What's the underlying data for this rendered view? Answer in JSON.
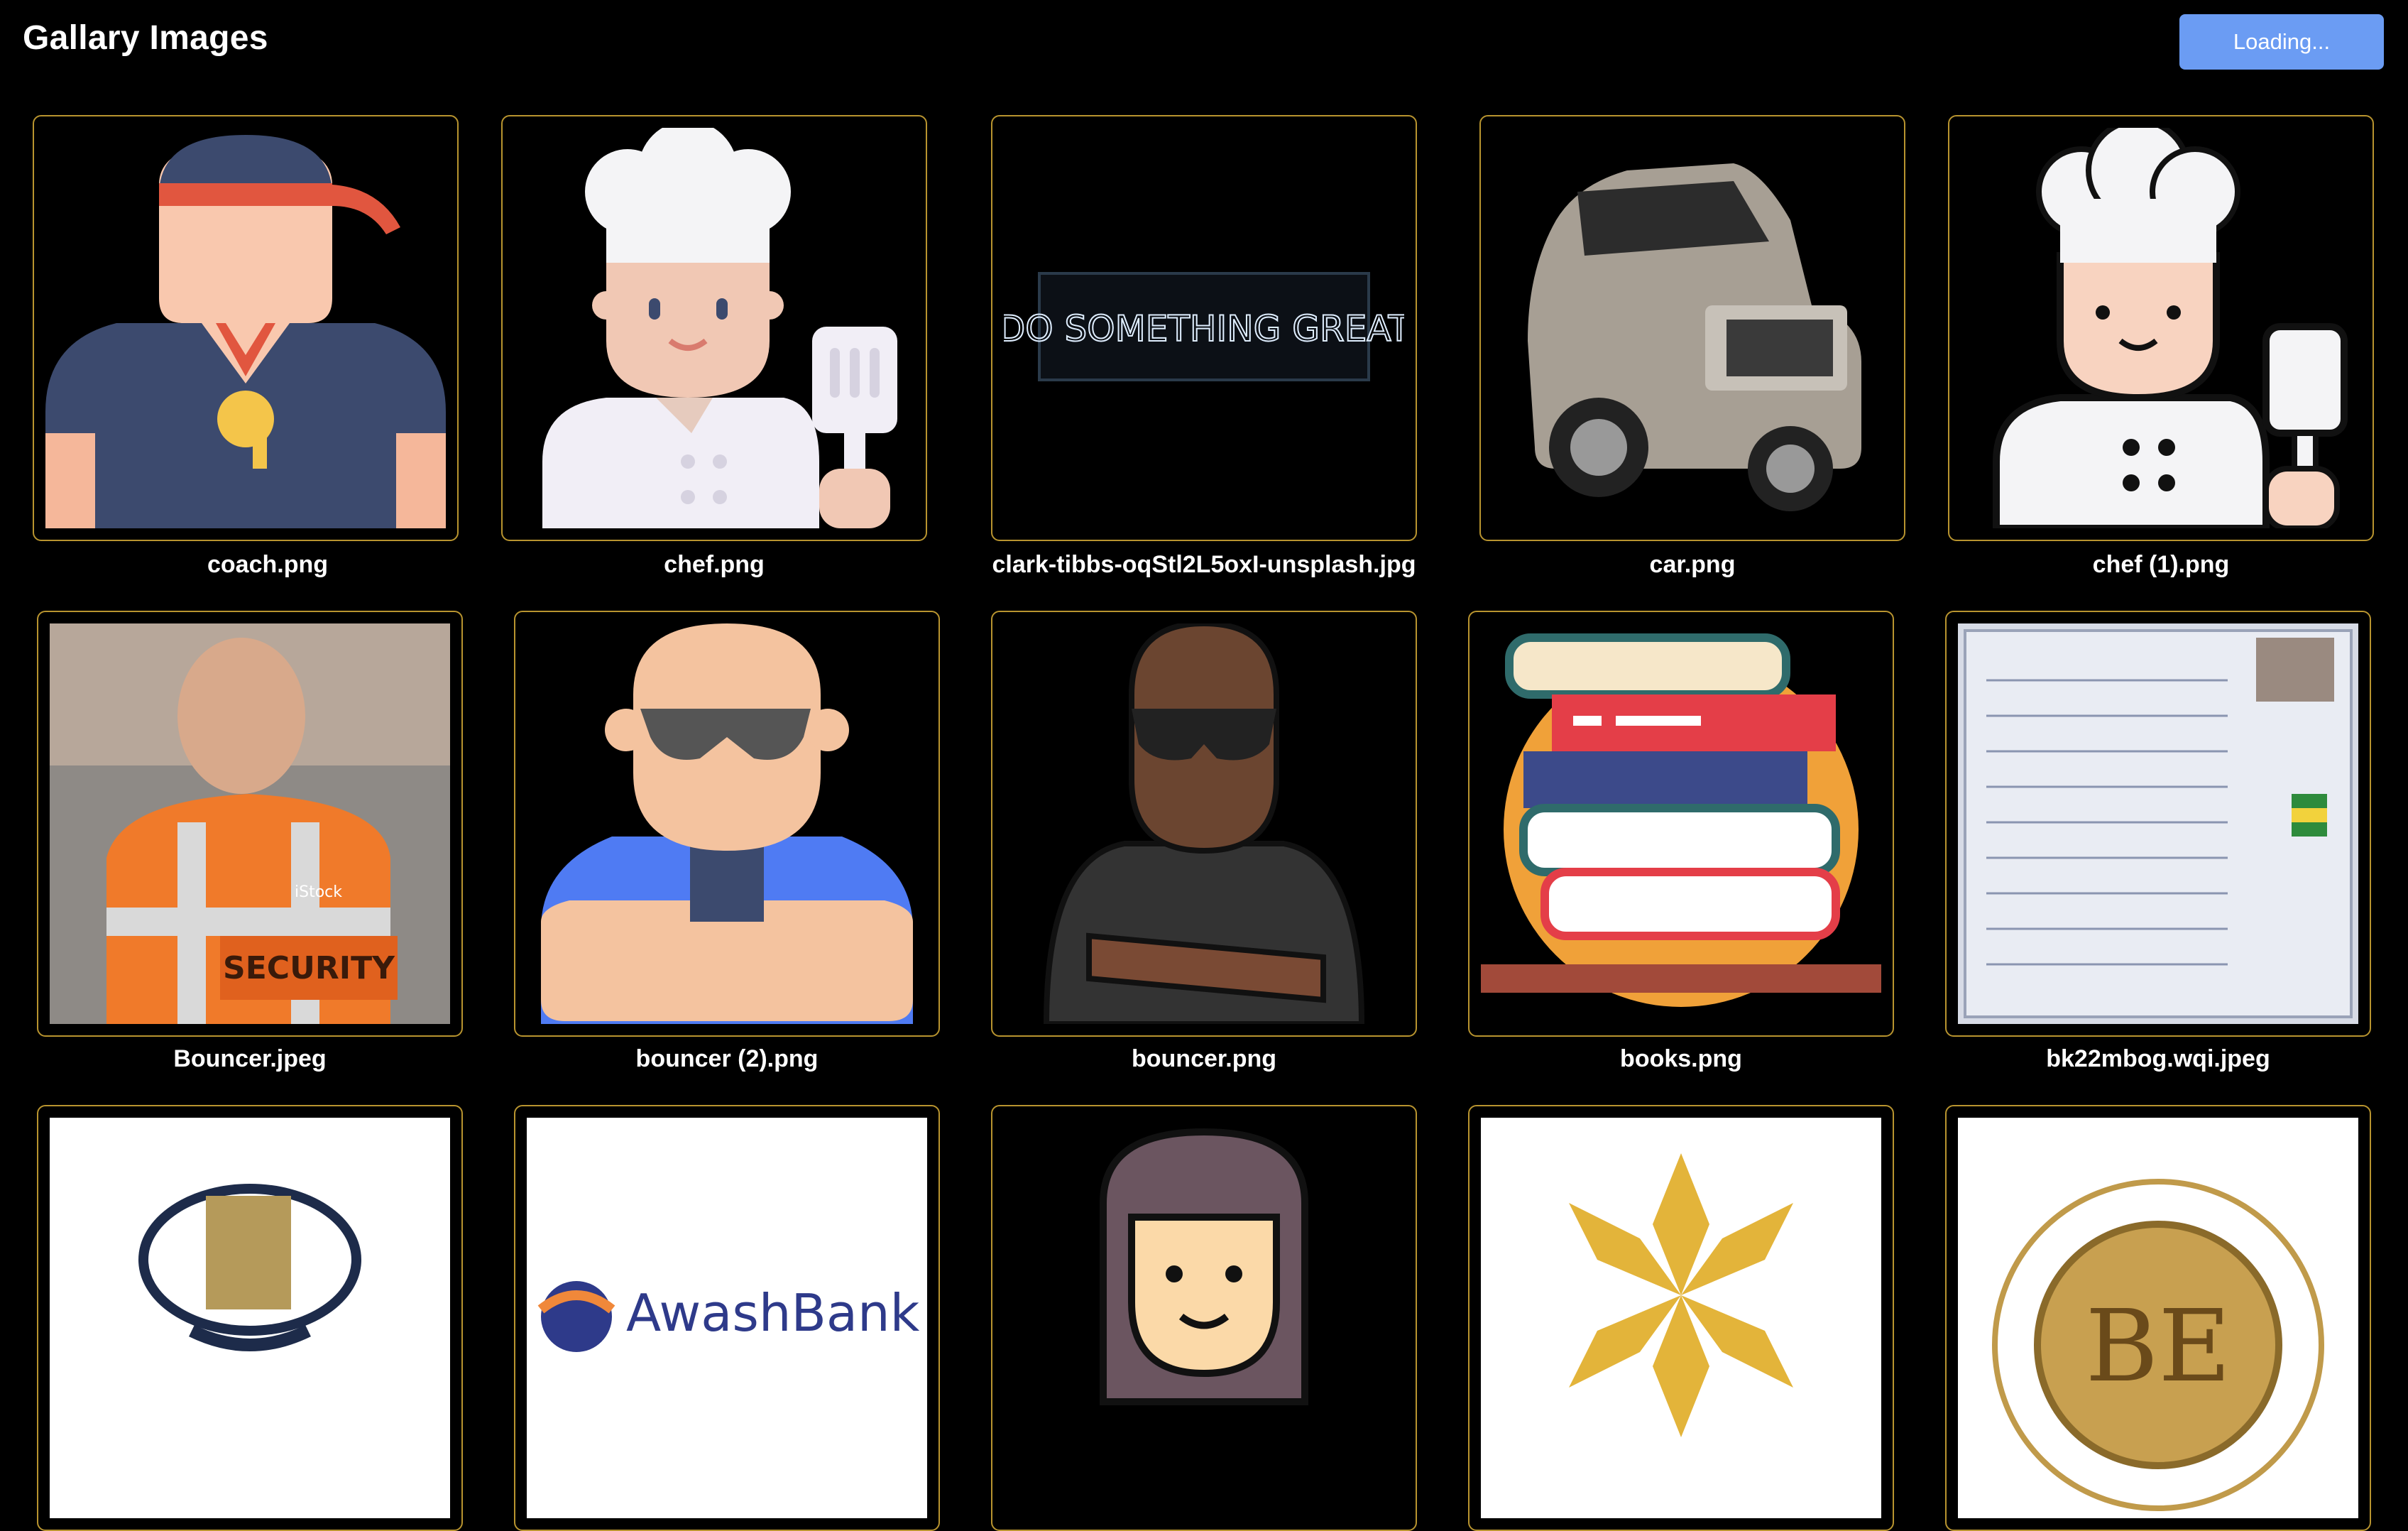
{
  "header": {
    "title": "Gallary Images",
    "loading_button": "Loading..."
  },
  "gallery": {
    "items": [
      {
        "name": "coach.png",
        "icon": "coach-icon"
      },
      {
        "name": "chef.png",
        "icon": "chef-icon"
      },
      {
        "name": "clark-tibbs-oqStl2L5oxI-unsplash.jpg",
        "icon": "neon-sign-photo",
        "sign_text": "DO SOMETHING GREAT"
      },
      {
        "name": "car.png",
        "icon": "car-photo"
      },
      {
        "name": "chef (1).png",
        "icon": "chef-icon"
      },
      {
        "name": "Bouncer.jpeg",
        "icon": "security-guard-photo",
        "badge_text": "SECURITY",
        "watermark": "iStock"
      },
      {
        "name": "bouncer (2).png",
        "icon": "bouncer-icon"
      },
      {
        "name": "bouncer.png",
        "icon": "bouncer-sketch-icon"
      },
      {
        "name": "books.png",
        "icon": "books-icon"
      },
      {
        "name": "bk22mbog.wqi.jpeg",
        "icon": "document-photo"
      },
      {
        "name": "",
        "icon": "university-logo"
      },
      {
        "name": "",
        "icon": "awash-bank-logo",
        "logo_text": "AwashBank"
      },
      {
        "name": "",
        "icon": "woman-avatar-icon"
      },
      {
        "name": "",
        "icon": "star-logo"
      },
      {
        "name": "",
        "icon": "gold-coin-logo",
        "logo_text": "BE"
      }
    ]
  },
  "colors": {
    "background": "#000000",
    "card_border": "#b8942f",
    "button": "#6b9cf3"
  }
}
